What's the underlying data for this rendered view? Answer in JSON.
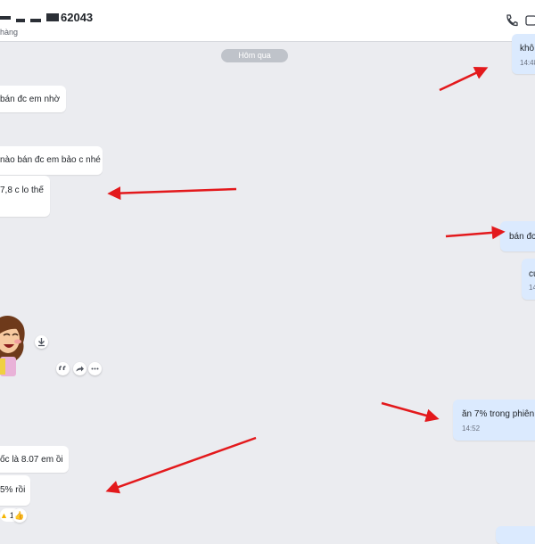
{
  "header": {
    "contact_name": "62043",
    "subtitle": "hàng",
    "icons": [
      "phone-icon",
      "video-call-icon"
    ]
  },
  "day_separator": "Hôm qua",
  "messages": [
    {
      "id": "m1",
      "direction": "out",
      "text": "khô",
      "time": "14:48"
    },
    {
      "id": "m2",
      "direction": "in",
      "text": "bán đc em nhờ"
    },
    {
      "id": "m3",
      "direction": "in",
      "text": "nào bán đc em bảo c nhé"
    },
    {
      "id": "m4",
      "direction": "in",
      "text": "7,8 c lo thế"
    },
    {
      "id": "m5",
      "direction": "out",
      "text": "bán đc"
    },
    {
      "id": "m6",
      "direction": "out",
      "text": "cu",
      "time": "14"
    },
    {
      "id": "m7",
      "direction": "out",
      "text": "ăn 7% trong phiên",
      "time": "14:52"
    },
    {
      "id": "m8",
      "direction": "in",
      "text": "ốc là 8.07 em ồi"
    },
    {
      "id": "m9",
      "direction": "in",
      "text": "5% rồi",
      "reaction_count": "1"
    }
  ],
  "sticker": {
    "icons": [
      "download-icon",
      "quote-icon",
      "share-icon",
      "more-icon"
    ]
  },
  "annotation": {
    "color": "#e3191c"
  }
}
